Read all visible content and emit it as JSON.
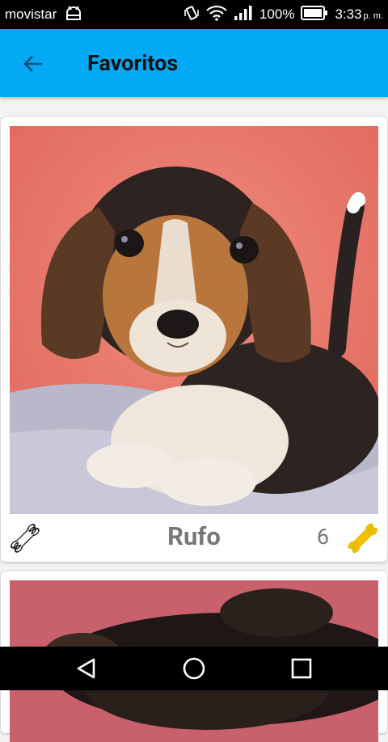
{
  "status": {
    "carrier": "movistar",
    "battery": "100%",
    "time": "3:33",
    "ampm": "p. m."
  },
  "appbar": {
    "title": "Favoritos",
    "back_icon": "arrow-back-icon",
    "color": "#03a9f4"
  },
  "cards": [
    {
      "name": "Rufo",
      "likes": "6",
      "photo": "beagle puppy on pink background",
      "fav_icon": "bone-outline-icon",
      "rate_icon": "bone-filled-icon"
    },
    {
      "photo": "puppy on pink background"
    }
  ],
  "colors": {
    "bone_filled": "#f2c200",
    "photo_bg": "#e8746a"
  },
  "navbar": {
    "back_icon": "nav-back-icon",
    "home_icon": "nav-home-icon",
    "recents_icon": "nav-recents-icon"
  }
}
